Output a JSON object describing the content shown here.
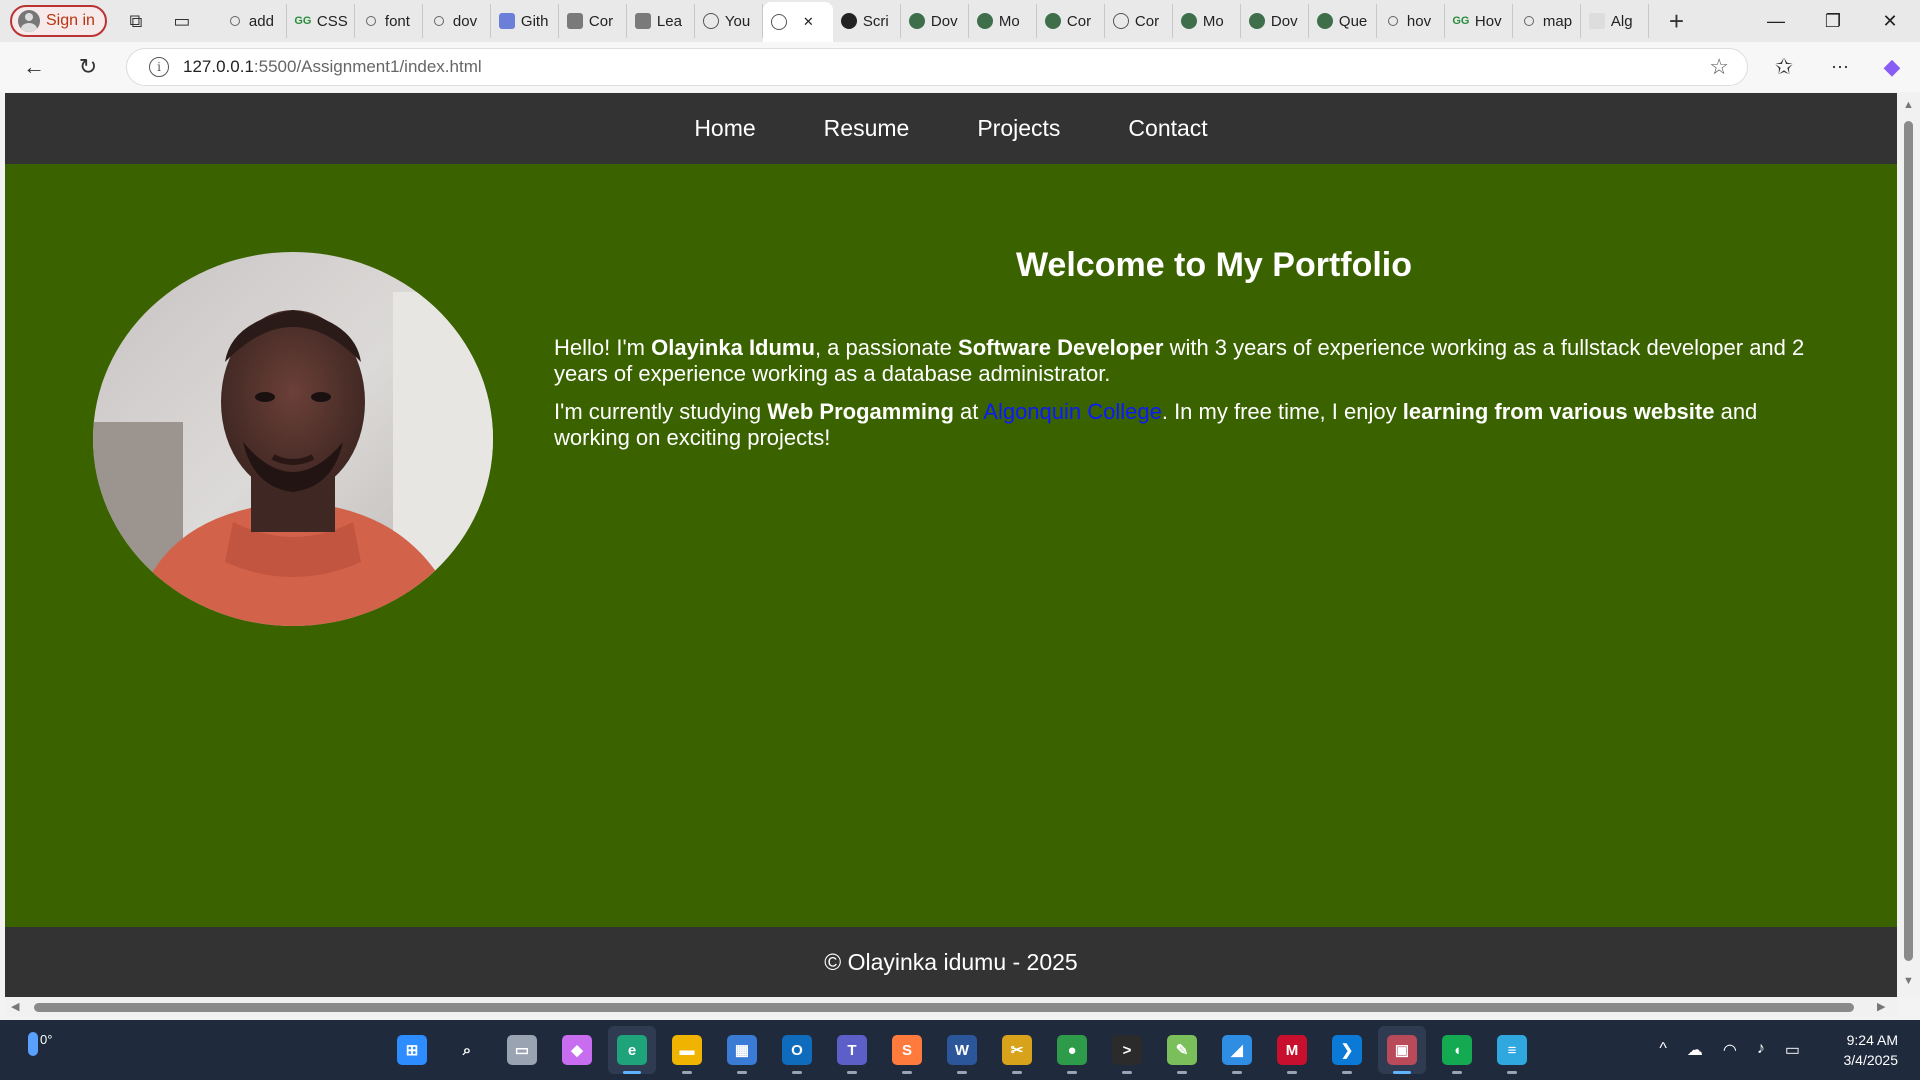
{
  "browser": {
    "sign_in_label": "Sign in",
    "tabs": [
      {
        "label": "add",
        "icon": "search"
      },
      {
        "label": "CSS",
        "icon": "gfg"
      },
      {
        "label": "font",
        "icon": "search"
      },
      {
        "label": "dov",
        "icon": "search"
      },
      {
        "label": "Gith",
        "icon": "blue"
      },
      {
        "label": "Cor",
        "icon": "grey"
      },
      {
        "label": "Lea",
        "icon": "grey"
      },
      {
        "label": "You",
        "icon": "globe"
      },
      {
        "label": "",
        "icon": "globe",
        "active": true
      },
      {
        "label": "Scri",
        "icon": "dark"
      },
      {
        "label": "Dov",
        "icon": "green"
      },
      {
        "label": "Mo",
        "icon": "green"
      },
      {
        "label": "Cor",
        "icon": "green"
      },
      {
        "label": "Cor",
        "icon": "globe"
      },
      {
        "label": "Mo",
        "icon": "green"
      },
      {
        "label": "Dov",
        "icon": "green"
      },
      {
        "label": "Que",
        "icon": "green"
      },
      {
        "label": "hov",
        "icon": "search"
      },
      {
        "label": "Hov",
        "icon": "gfg"
      },
      {
        "label": "map",
        "icon": "search"
      },
      {
        "label": "Alg",
        "icon": "doc"
      }
    ],
    "url_host": "127.0.0.1",
    "url_path": ":5500/Assignment1/index.html"
  },
  "site": {
    "nav": [
      "Home",
      "Resume",
      "Projects",
      "Contact"
    ],
    "heading": "Welcome to My Portfolio",
    "p1": {
      "t1": "Hello! I'm ",
      "name": "Olayinka Idumu",
      "t2": ", a passionate ",
      "role": "Software Developer",
      "t3": " with 3 years of experience working as a fullstack developer and 2 years of experience working as a database administrator."
    },
    "p2": {
      "t1": "I'm currently studying ",
      "course": "Web Progamming",
      "t2": " at ",
      "school": "Algonquin College",
      "t3": ". In my free time, I enjoy ",
      "hobby": "learning from various website",
      "t4": " and working on exciting projects!"
    },
    "footer": "© Olayinka idumu - 2025",
    "colors": {
      "nav_bg": "#333333",
      "body_bg": "#3a6300",
      "link": "#0a1aff"
    }
  },
  "taskbar": {
    "weather_temp": "0°",
    "time": "9:24 AM",
    "date": "3/4/2025"
  }
}
